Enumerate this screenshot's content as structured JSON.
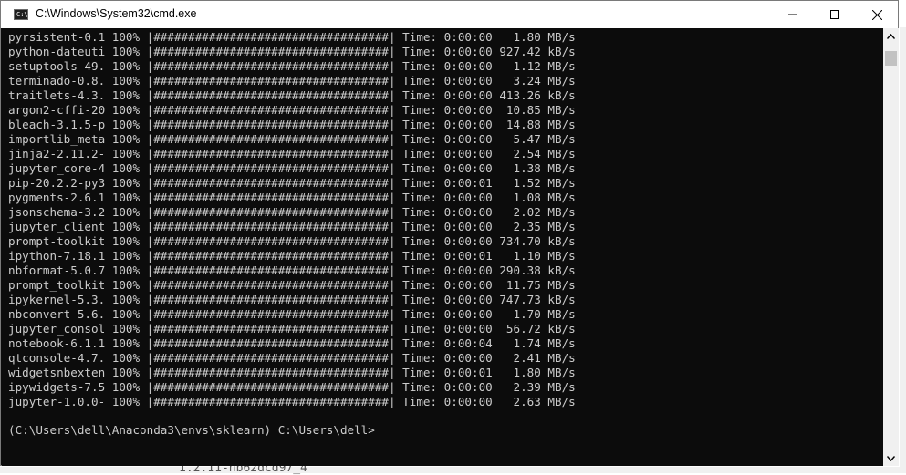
{
  "window": {
    "title": "C:\\Windows\\System32\\cmd.exe",
    "icon_text": "C:\\"
  },
  "console": {
    "lines": [
      "pyrsistent-0.1 100% |##################################| Time: 0:00:00   1.80 MB/s",
      "python-dateuti 100% |##################################| Time: 0:00:00 927.42 kB/s",
      "setuptools-49. 100% |##################################| Time: 0:00:00   1.12 MB/s",
      "terminado-0.8. 100% |##################################| Time: 0:00:00   3.24 MB/s",
      "traitlets-4.3. 100% |##################################| Time: 0:00:00 413.26 kB/s",
      "argon2-cffi-20 100% |##################################| Time: 0:00:00  10.85 MB/s",
      "bleach-3.1.5-p 100% |##################################| Time: 0:00:00  14.88 MB/s",
      "importlib_meta 100% |##################################| Time: 0:00:00   5.47 MB/s",
      "jinja2-2.11.2- 100% |##################################| Time: 0:00:00   2.54 MB/s",
      "jupyter_core-4 100% |##################################| Time: 0:00:00   1.38 MB/s",
      "pip-20.2.2-py3 100% |##################################| Time: 0:00:01   1.52 MB/s",
      "pygments-2.6.1 100% |##################################| Time: 0:00:00   1.08 MB/s",
      "jsonschema-3.2 100% |##################################| Time: 0:00:00   2.02 MB/s",
      "jupyter_client 100% |##################################| Time: 0:00:00   2.35 MB/s",
      "prompt-toolkit 100% |##################################| Time: 0:00:00 734.70 kB/s",
      "ipython-7.18.1 100% |##################################| Time: 0:00:01   1.10 MB/s",
      "nbformat-5.0.7 100% |##################################| Time: 0:00:00 290.38 kB/s",
      "prompt_toolkit 100% |##################################| Time: 0:00:00  11.75 MB/s",
      "ipykernel-5.3. 100% |##################################| Time: 0:00:00 747.73 kB/s",
      "nbconvert-5.6. 100% |##################################| Time: 0:00:00   1.70 MB/s",
      "jupyter_consol 100% |##################################| Time: 0:00:00  56.72 kB/s",
      "notebook-6.1.1 100% |##################################| Time: 0:00:04   1.74 MB/s",
      "qtconsole-4.7. 100% |##################################| Time: 0:00:00   2.41 MB/s",
      "widgetsnbexten 100% |##################################| Time: 0:00:01   1.80 MB/s",
      "ipywidgets-7.5 100% |##################################| Time: 0:00:00   2.39 MB/s",
      "jupyter-1.0.0- 100% |##################################| Time: 0:00:00   2.63 MB/s"
    ],
    "prompt": "(C:\\Users\\dell\\Anaconda3\\envs\\sklearn) C:\\Users\\dell>"
  },
  "background": {
    "partial_text": "1.2.11-hb62dcd97_4"
  },
  "icons": {
    "app": "cmd-icon",
    "minimize": "minimize-icon",
    "maximize": "maximize-icon",
    "close": "close-icon",
    "scroll_up": "scroll-up-icon",
    "scroll_down": "scroll-down-icon"
  },
  "colors": {
    "console_bg": "#0c0c0c",
    "console_fg": "#cccccc",
    "titlebar_bg": "#ffffff"
  }
}
